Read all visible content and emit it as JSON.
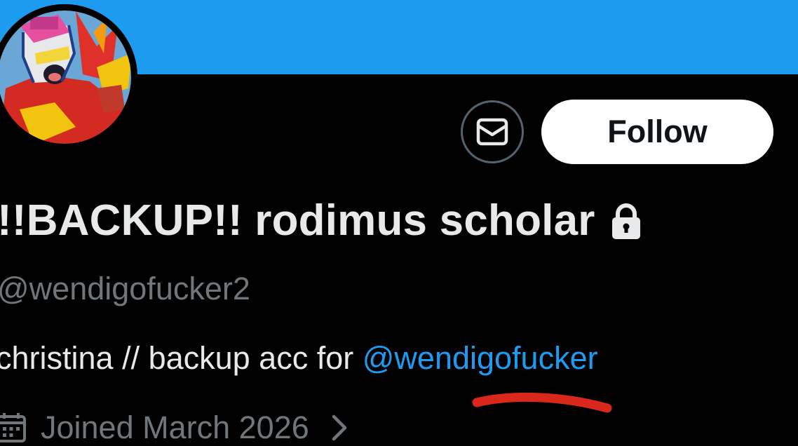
{
  "colors": {
    "banner": "#1d9bf0",
    "background": "#000000",
    "primary_text": "#e7e9ea",
    "secondary_text": "#71767b",
    "link": "#1d9bf0",
    "follow_bg": "#ffffff",
    "follow_text": "#0f1419",
    "annotation_red": "#d9281b"
  },
  "profile": {
    "avatar_icon": "avatar-image",
    "display_name": "!!BACKUP!! rodimus scholar",
    "protected_icon": "lock-icon",
    "handle": "@wendigofucker2",
    "bio_text": "christina // backup acc for ",
    "bio_mention": "@wendigofucker",
    "joined": "Joined March 2026",
    "joined_icon": "calendar-icon",
    "joined_chevron_icon": "chevron-right-icon"
  },
  "actions": {
    "message_icon": "envelope-icon",
    "follow_label": "Follow"
  }
}
